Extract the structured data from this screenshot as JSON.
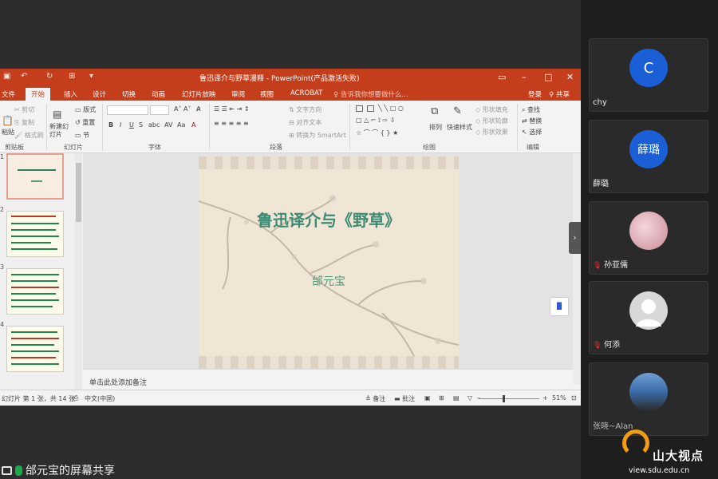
{
  "powerpoint": {
    "window_title": "鲁迅译介与野草漫释 - PowerPoint(产品激活失败)",
    "tabs": [
      "文件",
      "开始",
      "插入",
      "设计",
      "切换",
      "动画",
      "幻灯片放映",
      "审阅",
      "视图",
      "ACROBAT"
    ],
    "active_tab": "开始",
    "tell_me": "告诉我你想要做什么...",
    "login": "登录",
    "share": "共享",
    "ribbon": {
      "clipboard": {
        "cut": "剪切",
        "copy": "复制",
        "format_painter": "格式刷",
        "paste": "粘贴",
        "group": "剪贴板"
      },
      "slides": {
        "new_slide": "新建幻灯片",
        "layout": "版式",
        "reset": "重置",
        "section": "节",
        "group": "幻灯片"
      },
      "font_group": "字体",
      "paragraph": {
        "text_direction": "文字方向",
        "align_text": "对齐文本",
        "smartart": "转换为 SmartArt",
        "group": "段落"
      },
      "drawing": {
        "arrange": "排列",
        "quick_styles": "快速样式",
        "shape_fill": "形状填充",
        "shape_outline": "形状轮廓",
        "shape_effects": "形状效果",
        "group": "绘图"
      },
      "editing": {
        "find": "查找",
        "replace": "替换",
        "select": "选择",
        "group": "编辑"
      }
    },
    "thumb_numbers": [
      "1",
      "2",
      "3",
      "4"
    ],
    "slide": {
      "title": "鲁迅译介与《野草》",
      "author": "邰元宝"
    },
    "notes_placeholder": "单击此处添加备注",
    "status": {
      "slide_info": "幻灯片 第 1 张，共 14 张",
      "language": "中文(中国)",
      "notes": "备注",
      "comments": "批注",
      "zoom": "51%"
    }
  },
  "share_bar": {
    "label": "邰元宝的屏幕共享"
  },
  "participants": [
    {
      "name": "chy",
      "avatar_text": "C",
      "avatar_color": "#1a5fd6",
      "muted": false
    },
    {
      "name": "薛璐",
      "avatar_text": "薛璐",
      "avatar_color": "#1a5fd6",
      "muted": false
    },
    {
      "name": "孙亚儒",
      "avatar_text": "",
      "avatar_color": "#e8c9cf",
      "muted": true
    },
    {
      "name": "何添",
      "avatar_text": "",
      "avatar_color": "#d8d8d8",
      "muted": true
    },
    {
      "name": "张晓~Alan",
      "avatar_text": "",
      "avatar_color": "#3b6aa8",
      "muted": false
    }
  ],
  "watermark": {
    "brand": "山大视点",
    "url": "view.sdu.edu.cn"
  }
}
